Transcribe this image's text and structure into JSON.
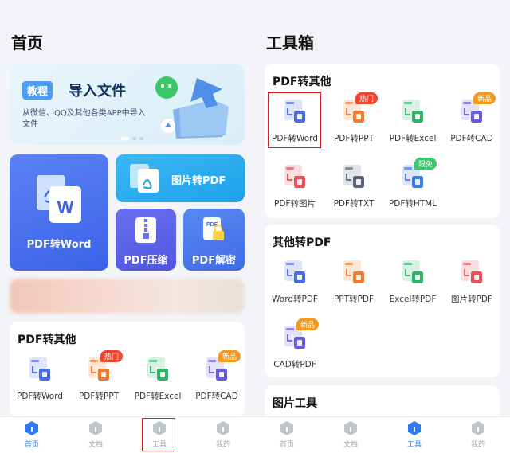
{
  "left": {
    "page_title": "首页",
    "banner": {
      "tag": "教程",
      "title": "导入文件",
      "subtitle": "从微信、QQ及其他各类APP中导入文件"
    },
    "tiles": {
      "pdf_word": "PDF转Word",
      "img_pdf": "图片转PDF",
      "pdf_zip": "PDF压缩",
      "pdf_decrypt": "PDF解密"
    },
    "section": {
      "title": "PDF转其他",
      "tools": [
        {
          "label": "PDF转Word",
          "icon": "pdf-to-word-icon",
          "color": "#4a6ee0"
        },
        {
          "label": "PDF转PPT",
          "icon": "pdf-to-ppt-icon",
          "color": "#f07a2e",
          "badge": "热门"
        },
        {
          "label": "PDF转Excel",
          "icon": "pdf-to-excel-icon",
          "color": "#2fb36b"
        },
        {
          "label": "PDF转CAD",
          "icon": "pdf-to-cad-icon",
          "color": "#6a5cd8",
          "badge": "新品"
        }
      ]
    },
    "tabbar": [
      {
        "label": "首页",
        "icon": "home-icon",
        "active": true
      },
      {
        "label": "文档",
        "icon": "folder-icon"
      },
      {
        "label": "工具",
        "icon": "toolbox-icon"
      },
      {
        "label": "我的",
        "icon": "user-icon"
      }
    ]
  },
  "right": {
    "page_title": "工具箱",
    "section1": {
      "title": "PDF转其他",
      "tools": [
        {
          "label": "PDF转Word",
          "icon": "pdf-to-word-icon",
          "color": "#4a6ee0"
        },
        {
          "label": "PDF转PPT",
          "icon": "pdf-to-ppt-icon",
          "color": "#f07a2e",
          "badge": "热门"
        },
        {
          "label": "PDF转Excel",
          "icon": "pdf-to-excel-icon",
          "color": "#2fb36b"
        },
        {
          "label": "PDF转CAD",
          "icon": "pdf-to-cad-icon",
          "color": "#6a5cd8",
          "badge": "新品"
        },
        {
          "label": "PDF转图片",
          "icon": "pdf-to-image-icon",
          "color": "#e5505a"
        },
        {
          "label": "PDF转TXT",
          "icon": "pdf-to-txt-icon",
          "color": "#5a6478"
        },
        {
          "label": "PDF转HTML",
          "icon": "pdf-to-html-icon",
          "color": "#3b7de6",
          "badge": "限免"
        }
      ]
    },
    "section2": {
      "title": "其他转PDF",
      "tools": [
        {
          "label": "Word转PDF",
          "icon": "word-to-pdf-icon",
          "color": "#4a6ee0"
        },
        {
          "label": "PPT转PDF",
          "icon": "ppt-to-pdf-icon",
          "color": "#f07a2e"
        },
        {
          "label": "Excel转PDF",
          "icon": "excel-to-pdf-icon",
          "color": "#2fb36b"
        },
        {
          "label": "图片转PDF",
          "icon": "image-to-pdf-icon",
          "color": "#e5505a"
        },
        {
          "label": "CAD转PDF",
          "icon": "cad-to-pdf-icon",
          "color": "#6a5cd8",
          "badge": "新品"
        }
      ]
    },
    "section3": {
      "title": "图片工具"
    },
    "tabbar": [
      {
        "label": "首页",
        "icon": "home-icon"
      },
      {
        "label": "文档",
        "icon": "folder-icon"
      },
      {
        "label": "工具",
        "icon": "toolbox-icon",
        "active": true
      },
      {
        "label": "我的",
        "icon": "user-icon"
      }
    ]
  }
}
